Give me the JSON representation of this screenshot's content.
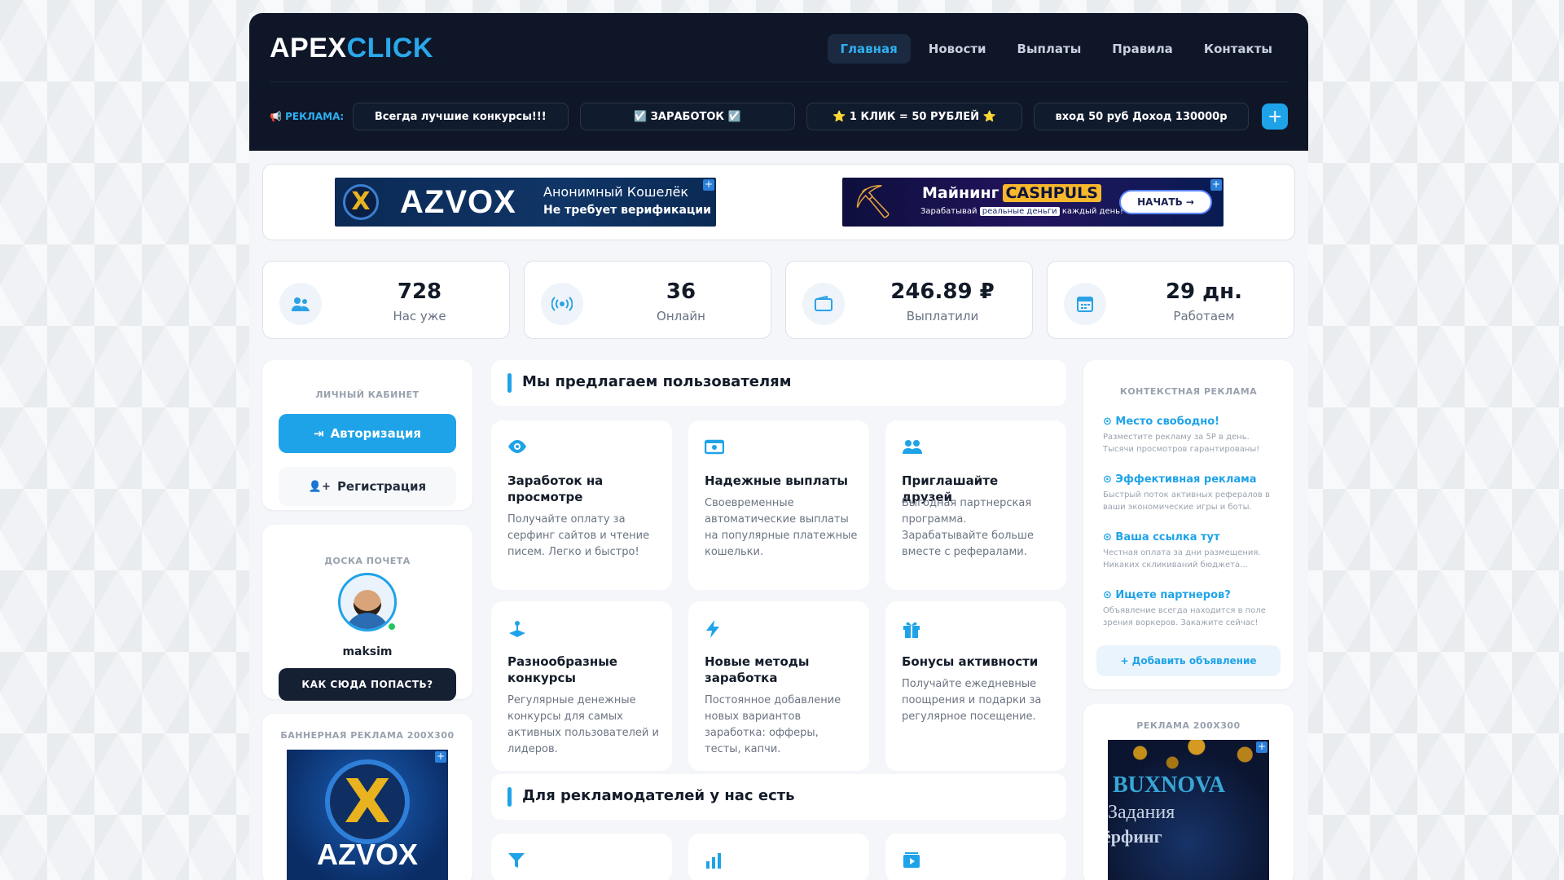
{
  "header": {
    "logo_a": "APEX",
    "logo_b": "CLICK",
    "nav": [
      "Главная",
      "Новости",
      "Выплаты",
      "Правила",
      "Контакты"
    ],
    "ad_label": "📢 РЕКЛАМА:",
    "ads": [
      "Всегда лучшие конкурсы!!!",
      "☑️ ЗАРАБОТОК ☑️",
      "⭐ 1 КЛИК = 50 РУБЛЕЙ ⭐",
      "вход 50 руб Доход 130000р"
    ],
    "ad_plus": "+"
  },
  "banners": {
    "azvox": {
      "brand": "AZVOX",
      "line1": "Анонимный Кошелёк",
      "line2": "Не требует верификации",
      "emblem": "X"
    },
    "cashpuls": {
      "line1a": "Майнинг",
      "line1b": "CASHPULS",
      "line2a": "Зарабатывай",
      "line2b": "реальные деньги",
      "line2c": "каждый день!",
      "cta": "НАЧАТЬ →"
    }
  },
  "stats": [
    {
      "value": "728",
      "label": "Нас уже",
      "icon": "users-icon"
    },
    {
      "value": "36",
      "label": "Онлайн",
      "icon": "broadcast-icon"
    },
    {
      "value": "246.89 ₽",
      "label": "Выплатили",
      "icon": "wallet-icon"
    },
    {
      "value": "29 дн.",
      "label": "Работаем",
      "icon": "calendar-icon"
    }
  ],
  "cabinet": {
    "title": "ЛИЧНЫЙ КАБИНЕТ",
    "login": "Авторизация",
    "register": "Регистрация"
  },
  "honor": {
    "title": "ДОСКА ПОЧЕТА",
    "username": "maksim",
    "cta": "КАК СЮДА ПОПАСТЬ?"
  },
  "banner_left": {
    "title": "БАННЕРНАЯ РЕКЛАМА 200Х300",
    "brand": "AZVOX",
    "emblem": "X"
  },
  "offers": {
    "title": "Мы предлагаем пользователям",
    "items": [
      {
        "title": "Заработок на просмотре",
        "desc": "Получайте оплату за серфинг сайтов и чтение писем. Легко и быстро!",
        "icon": "eye-icon"
      },
      {
        "title": "Надежные выплаты",
        "desc": "Своевременные автоматические выплаты на популярные платежные кошельки.",
        "icon": "money-icon"
      },
      {
        "title": "Приглашайте друзей",
        "desc": "Выгодная партнерская программа. Зарабатывайте больше вместе с рефералами.",
        "icon": "friends-icon"
      },
      {
        "title": "Разнообразные конкурсы",
        "desc": "Регулярные денежные конкурсы для самых активных пользователей и лидеров.",
        "icon": "joystick-icon"
      },
      {
        "title": "Новые методы заработка",
        "desc": "Постоянное добавление новых вариантов заработка: офферы, тесты, капчи.",
        "icon": "bolt-icon"
      },
      {
        "title": "Бонусы активности",
        "desc": "Получайте ежедневные поощрения и подарки за регулярное посещение.",
        "icon": "gift-icon"
      }
    ]
  },
  "advertisers": {
    "title": "Для рекламодателей у нас есть"
  },
  "context_ads": {
    "title": "КОНТЕКСТНАЯ РЕКЛАМА",
    "items": [
      {
        "title": "Место свободно!",
        "desc": "Разместите рекламу за 5Р в день. Тысячи просмотров гарантированы!"
      },
      {
        "title": "Эффективная реклама",
        "desc": "Быстрый поток активных рефералов в ваши экономические игры и боты."
      },
      {
        "title": "Ваша ссылка тут",
        "desc": "Честная оплата за дни размещения. Никаких скликиваний бюджета..."
      },
      {
        "title": "Ищете партнеров?",
        "desc": "Объявление всегда находится в поле зрения воркеров. Закажите сейчас!"
      }
    ],
    "add": "+ Добавить объявление"
  },
  "banner_right": {
    "title": "РЕКЛАМА 200Х300",
    "line1": "BUXNOVA",
    "line2": "Задания",
    "line3": "ёрфинг"
  }
}
